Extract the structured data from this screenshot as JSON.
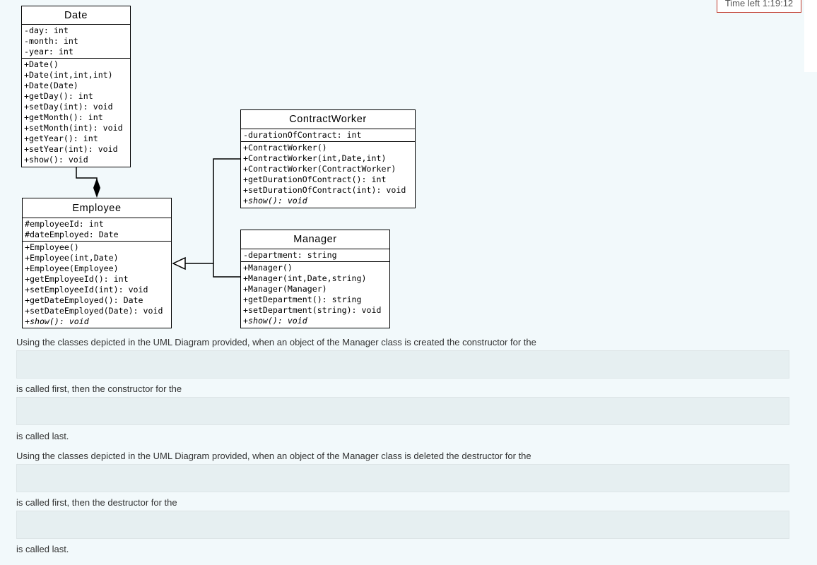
{
  "timer": {
    "label": "Time left 1:19:12"
  },
  "uml": {
    "date": {
      "name": "Date",
      "attributes": [
        "-day: int",
        "-month: int",
        "-year: int"
      ],
      "methods": [
        "+Date()",
        "+Date(int,int,int)",
        "+Date(Date)",
        "+getDay(): int",
        "+setDay(int): void",
        "+getMonth(): int",
        "+setMonth(int): void",
        "+getYear(): int",
        "+setYear(int): void",
        "+show(): void"
      ]
    },
    "employee": {
      "name": "Employee",
      "attributes": [
        "#employeeId: int",
        "#dateEmployed: Date"
      ],
      "methods": [
        "+Employee()",
        "+Employee(int,Date)",
        "+Employee(Employee)",
        "+getEmployeeId(): int",
        "+setEmployeeId(int): void",
        "+getDateEmployed(): Date",
        "+setDateEmployed(Date): void"
      ],
      "italic_method": "+show(): void"
    },
    "contract_worker": {
      "name": "ContractWorker",
      "attributes": [
        "-durationOfContract: int"
      ],
      "methods": [
        "+ContractWorker()",
        "+ContractWorker(int,Date,int)",
        "+ContractWorker(ContractWorker)",
        "+getDurationOfContract(): int",
        "+setDurationOfContract(int): void"
      ],
      "italic_method": "+show(): void"
    },
    "manager": {
      "name": "Manager",
      "attributes": [
        "-department: string"
      ],
      "methods": [
        "+Manager()",
        "+Manager(int,Date,string)",
        "+Manager(Manager)",
        "+getDepartment(): string",
        "+setDepartment(string): void"
      ],
      "italic_method": "+show(): void"
    }
  },
  "question": {
    "ctor_intro": "Using the classes depicted in the UML Diagram provided, when an object of the Manager class is created the constructor for the",
    "ctor_middle": "is called first, then the constructor for the",
    "ctor_end": "is called last.",
    "dtor_intro": "Using the classes depicted in the UML Diagram provided, when an object of the Manager class is deleted the destructor for the",
    "dtor_middle": "is called first, then the destructor for the",
    "dtor_end": "is called last."
  },
  "answers": {
    "ctor_first": "",
    "ctor_last": "",
    "dtor_first": "",
    "dtor_last": ""
  }
}
